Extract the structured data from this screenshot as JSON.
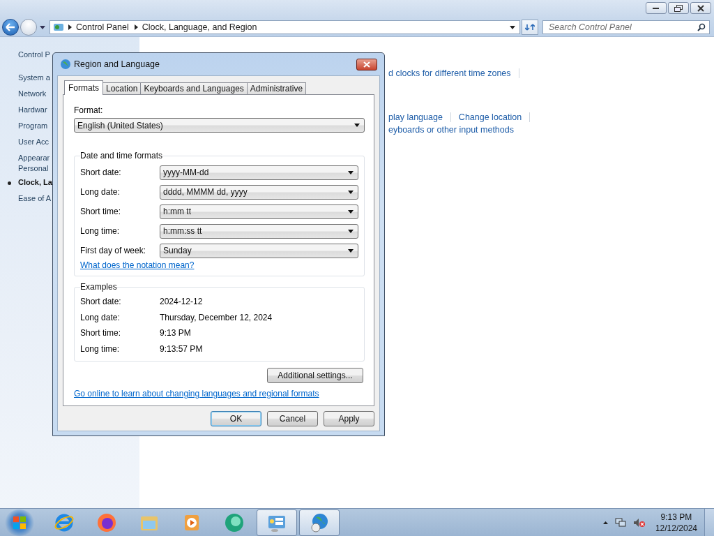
{
  "navigation": {
    "breadcrumb": [
      "Control Panel",
      "Clock, Language, and Region"
    ],
    "search": {
      "placeholder": "Search Control Panel"
    }
  },
  "sidebar": {
    "items": [
      {
        "lines": [
          "Control P"
        ],
        "selected": false
      },
      {
        "lines": [
          "System a"
        ],
        "selected": false
      },
      {
        "lines": [
          "Network"
        ],
        "selected": false
      },
      {
        "lines": [
          "Hardwar"
        ],
        "selected": false
      },
      {
        "lines": [
          "Program"
        ],
        "selected": false
      },
      {
        "lines": [
          "User Acc"
        ],
        "selected": false
      },
      {
        "lines": [
          "Appearar",
          "Personal"
        ],
        "selected": false
      },
      {
        "lines": [
          "Clock, La"
        ],
        "selected": true
      },
      {
        "lines": [
          "Ease of A"
        ],
        "selected": false
      }
    ]
  },
  "main_links": [
    {
      "links": [
        "d clocks for different time zones"
      ],
      "trailing_divider": true
    },
    {
      "links": [
        "play language",
        "Change location"
      ],
      "trailing_divider": true
    },
    {
      "links": [
        "eyboards or other input methods"
      ],
      "trailing_divider": false
    }
  ],
  "dialog": {
    "title": "Region and Language",
    "tabs": [
      {
        "label": "Formats",
        "selected": true
      },
      {
        "label": "Location",
        "selected": false
      },
      {
        "label": "Keyboards and Languages",
        "selected": false
      },
      {
        "label": "Administrative",
        "selected": false
      }
    ],
    "format_label": "Format:",
    "format_value": "English (United States)",
    "formats_group": "Date and time formats",
    "fields": [
      {
        "label": "Short date:",
        "value": "yyyy-MM-dd"
      },
      {
        "label": "Long date:",
        "value": "dddd, MMMM dd, yyyy"
      },
      {
        "label": "Short time:",
        "value": "h:mm tt"
      },
      {
        "label": "Long time:",
        "value": "h:mm:ss tt"
      },
      {
        "label": "First day of week:",
        "value": "Sunday"
      }
    ],
    "notation_link": "What does the notation mean?",
    "examples_group": "Examples",
    "examples": [
      {
        "label": "Short date:",
        "value": "2024-12-12"
      },
      {
        "label": "Long date:",
        "value": "Thursday, December 12, 2024"
      },
      {
        "label": "Short time:",
        "value": "9:13 PM"
      },
      {
        "label": "Long time:",
        "value": "9:13:57 PM"
      }
    ],
    "additional_button": "Additional settings...",
    "online_link": "Go online to learn about changing languages and regional formats",
    "buttons": [
      {
        "label": "OK",
        "default": true
      },
      {
        "label": "Cancel",
        "default": false
      },
      {
        "label": "Apply",
        "default": false
      }
    ]
  },
  "taskbar": {
    "apps": [
      {
        "kind": "ie",
        "active": false
      },
      {
        "kind": "firefox",
        "active": false
      },
      {
        "kind": "folder",
        "active": false
      },
      {
        "kind": "media",
        "active": false
      },
      {
        "kind": "sphere",
        "active": false
      },
      {
        "kind": "control",
        "active": true
      },
      {
        "kind": "globe",
        "active": true
      }
    ],
    "time": "9:13 PM",
    "date": "12/12/2024"
  }
}
